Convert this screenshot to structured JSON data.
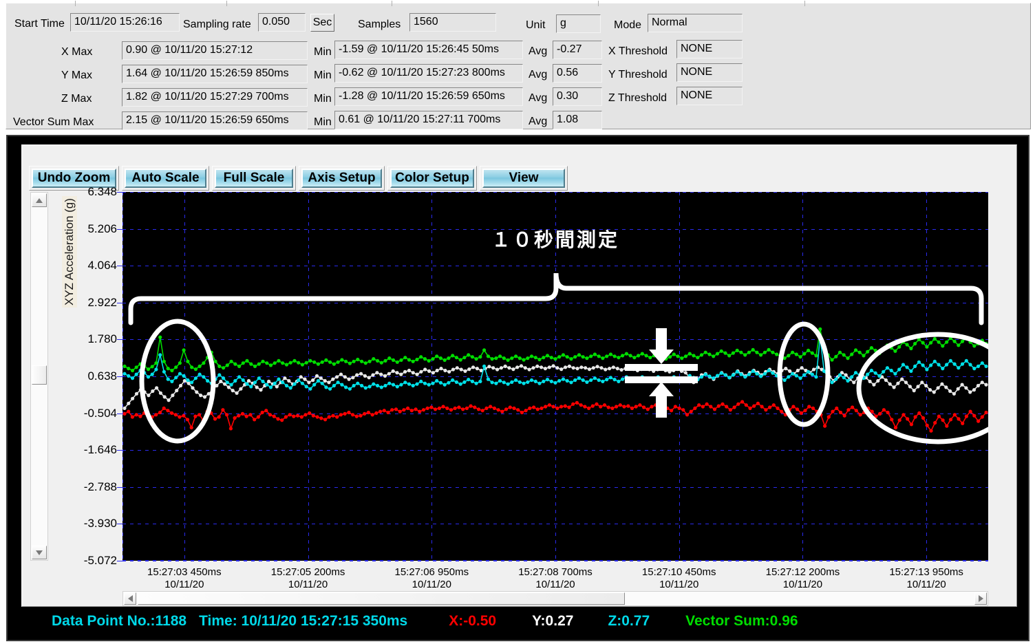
{
  "header": {
    "start_time_label": "Start Time",
    "start_time_value": "10/11/20 15:26:16",
    "sampling_rate_label": "Sampling rate",
    "sampling_rate_value": "0.050",
    "sec_button": "Sec",
    "samples_label": "Samples",
    "samples_value": "1560",
    "unit_label": "Unit",
    "unit_value": "g",
    "mode_label": "Mode",
    "mode_value": "Normal",
    "rows": [
      {
        "axis": "X  Max",
        "max_value": "0.90 @ 10/11/20 15:27:12",
        "min_label": "Min",
        "min_value": "-1.59 @ 10/11/20 15:26:45 50ms",
        "avg_label": "Avg",
        "avg_value": "-0.27",
        "threshold_label": "X Threshold",
        "threshold_value": "NONE"
      },
      {
        "axis": "Y Max",
        "max_value": "1.64 @ 10/11/20 15:26:59 850ms",
        "min_label": "Min",
        "min_value": "-0.62 @ 10/11/20 15:27:23 800ms",
        "avg_label": "Avg",
        "avg_value": "0.56",
        "threshold_label": "Y Threshold",
        "threshold_value": "NONE"
      },
      {
        "axis": "Z  Max",
        "max_value": "1.82 @ 10/11/20 15:27:29 700ms",
        "min_label": "Min",
        "min_value": "-1.28 @ 10/11/20 15:26:59 650ms",
        "avg_label": "Avg",
        "avg_value": "0.30",
        "threshold_label": "Z Threshold",
        "threshold_value": "NONE"
      },
      {
        "axis": "Vector Sum Max",
        "max_value": "2.15 @ 10/11/20 15:26:59 650ms",
        "min_label": "Min",
        "min_value": "0.61 @ 10/11/20 15:27:11 700ms",
        "avg_label": "Avg",
        "avg_value": "1.08",
        "threshold_label": "",
        "threshold_value": ""
      }
    ]
  },
  "toolbar": {
    "buttons": [
      {
        "label": "Undo Zoom",
        "name": "undo-zoom-button"
      },
      {
        "label": "Auto Scale",
        "name": "auto-scale-button"
      },
      {
        "label": "Full Scale",
        "name": "full-scale-button"
      },
      {
        "label": "Axis Setup",
        "name": "axis-setup-button"
      },
      {
        "label": "Color Setup",
        "name": "color-setup-button"
      },
      {
        "label": "View",
        "name": "view-button"
      }
    ]
  },
  "statusbar": {
    "data_point": "Data Point No.:1188",
    "time": "Time: 10/11/20 15:27:15 350ms",
    "x": "X:-0.50",
    "y": "Y:0.27",
    "z": "Z:0.77",
    "vector_sum": "Vector Sum:0.96",
    "colors": {
      "data_point": "#00d8e8",
      "time": "#00d8e8",
      "x": "#ff0000",
      "y": "#ffffff",
      "z": "#00d8e8",
      "vector_sum": "#00dd00"
    }
  },
  "annotations": {
    "bracket_text": "１０秒間測定",
    "ellipse_count": 3,
    "arrow_pair": "double-arrow-gap-marker"
  },
  "chart_data": {
    "type": "line",
    "title": "",
    "xlabel": "",
    "ylabel": "XYZ Acceleration (g)",
    "ylim": [
      -5.072,
      6.348
    ],
    "grid": true,
    "background": "#000000",
    "legend_position": "none",
    "yticks": [
      "6.348",
      "5.206",
      "4.064",
      "2.922",
      "1.780",
      "0.638",
      "-0.504",
      "-1.646",
      "-2.788",
      "-3.930",
      "-5.072"
    ],
    "ytick_values": [
      6.348,
      5.206,
      4.064,
      2.922,
      1.78,
      0.638,
      -0.504,
      -1.646,
      -2.788,
      -3.93,
      -5.072
    ],
    "xticks": [
      {
        "time": "15:27:03 450ms",
        "date": "10/11/20"
      },
      {
        "time": "15:27:05 200ms",
        "date": "10/11/20"
      },
      {
        "time": "15:27:06 950ms",
        "date": "10/11/20"
      },
      {
        "time": "15:27:08 700ms",
        "date": "10/11/20"
      },
      {
        "time": "15:27:10 450ms",
        "date": "10/11/20"
      },
      {
        "time": "15:27:12 200ms",
        "date": "10/11/20"
      },
      {
        "time": "15:27:13 950ms",
        "date": "10/11/20"
      }
    ],
    "series": [
      {
        "name": "X",
        "color": "#ff0000",
        "values": [
          -0.52,
          -0.45,
          -0.62,
          -0.55,
          -0.6,
          -0.5,
          -0.58,
          -0.62,
          -0.55,
          -0.48,
          -0.35,
          -0.42,
          -0.5,
          -0.55,
          -0.62,
          -0.58,
          -0.7,
          -0.95,
          -0.6,
          -0.55,
          -0.72,
          -0.45,
          -0.5,
          -0.68,
          -0.62,
          -0.4,
          -0.55,
          -0.98,
          -0.65,
          -0.58,
          -0.52,
          -0.6,
          -0.55,
          -0.7,
          -0.62,
          -0.48,
          -0.42,
          -0.55,
          -0.6,
          -0.68,
          -0.72,
          -0.62,
          -0.55,
          -0.6,
          -0.58,
          -0.62,
          -0.55,
          -0.5,
          -0.58,
          -0.62,
          -0.66,
          -0.7,
          -0.62,
          -0.58,
          -0.62,
          -0.55,
          -0.52,
          -0.48,
          -0.55,
          -0.6,
          -0.58,
          -0.52,
          -0.48,
          -0.55,
          -0.5,
          -0.45,
          -0.42,
          -0.48,
          -0.4,
          -0.38,
          -0.45,
          -0.4,
          -0.35,
          -0.42,
          -0.38,
          -0.45,
          -0.4,
          -0.35,
          -0.32,
          -0.38,
          -0.35,
          -0.3,
          -0.35,
          -0.4,
          -0.35,
          -0.32,
          -0.38,
          -0.35,
          -0.28,
          -0.32,
          -0.38,
          -0.42,
          -0.35,
          -0.3,
          -0.35,
          -0.4,
          -0.45,
          -0.38,
          -0.32,
          -0.35,
          -0.4,
          -0.48,
          -0.42,
          -0.35,
          -0.32,
          -0.38,
          -0.35,
          -0.3,
          -0.25,
          -0.3,
          -0.35,
          -0.3,
          -0.28,
          -0.32,
          -0.22,
          -0.18,
          -0.25,
          -0.3,
          -0.35,
          -0.28,
          -0.22,
          -0.3,
          -0.25,
          -0.32,
          -0.35,
          -0.3,
          -0.25,
          -0.3,
          -0.28,
          -0.35,
          -0.3,
          -0.25,
          -0.32,
          -0.38,
          -0.3,
          -0.25,
          -0.2,
          -0.28,
          -0.35,
          -0.42,
          -0.3,
          -0.35,
          -0.4,
          -0.55,
          -0.45,
          -0.35,
          -0.25,
          -0.3,
          -0.22,
          -0.3,
          -0.38,
          -0.28,
          -0.22,
          -0.3,
          -0.4,
          -0.32,
          -0.22,
          -0.15,
          -0.25,
          -0.35,
          -0.28,
          -0.2,
          -0.3,
          -0.4,
          -0.32,
          -0.25,
          -0.35,
          -0.45,
          -0.55,
          -0.4,
          -0.3,
          -0.38,
          -0.5,
          -0.42,
          -0.3,
          -0.35,
          -0.45,
          -0.55,
          -0.9,
          -0.62,
          -0.45,
          -0.35,
          -0.48,
          -0.58,
          -0.4,
          -0.32,
          -0.42,
          -0.55,
          -0.48,
          -0.35,
          -0.45,
          -0.6,
          -0.52,
          -0.4,
          -0.48,
          -0.7,
          -0.95,
          -0.72,
          -0.55,
          -0.68,
          -0.85,
          -0.62,
          -0.5,
          -0.65,
          -0.88,
          -1.05,
          -0.8,
          -0.6,
          -0.72,
          -0.9,
          -0.7,
          -0.55,
          -0.68,
          -0.82,
          -0.6,
          -0.45,
          -0.58,
          -0.75,
          -0.62,
          -0.48
        ]
      },
      {
        "name": "Y",
        "color": "#e8e8e8",
        "values": [
          -0.35,
          -0.2,
          -0.05,
          0.1,
          0.22,
          0.15,
          0.05,
          0.18,
          0.28,
          0.12,
          0.0,
          -0.1,
          0.05,
          0.2,
          0.35,
          0.5,
          0.42,
          0.28,
          0.15,
          0.05,
          0.0,
          0.1,
          0.22,
          0.35,
          0.48,
          0.4,
          0.3,
          0.2,
          0.12,
          0.25,
          0.38,
          0.5,
          0.42,
          0.3,
          0.22,
          0.35,
          0.48,
          0.4,
          0.32,
          0.45,
          0.58,
          0.5,
          0.4,
          0.48,
          0.62,
          0.55,
          0.45,
          0.52,
          0.65,
          0.58,
          0.5,
          0.45,
          0.55,
          0.62,
          0.7,
          0.62,
          0.55,
          0.6,
          0.68,
          0.72,
          0.65,
          0.6,
          0.68,
          0.75,
          0.7,
          0.65,
          0.72,
          0.8,
          0.75,
          0.7,
          0.78,
          0.82,
          0.75,
          0.7,
          0.78,
          0.85,
          0.8,
          0.75,
          0.82,
          0.88,
          0.82,
          0.78,
          0.85,
          0.9,
          0.85,
          0.8,
          0.86,
          0.92,
          0.88,
          0.82,
          0.88,
          0.94,
          0.9,
          0.85,
          0.9,
          0.95,
          0.9,
          0.86,
          0.92,
          0.96,
          0.9,
          0.85,
          0.9,
          0.95,
          0.92,
          0.88,
          0.92,
          0.96,
          0.9,
          0.86,
          0.92,
          0.95,
          0.9,
          0.88,
          0.92,
          0.9,
          0.86,
          0.9,
          0.94,
          0.9,
          0.85,
          0.88,
          0.92,
          0.88,
          0.84,
          0.88,
          0.92,
          0.86,
          0.82,
          0.86,
          0.9,
          0.85,
          0.8,
          0.85,
          0.88,
          0.82,
          0.78,
          0.82,
          0.86,
          0.8,
          0.75,
          0.6,
          0.45,
          0.55,
          0.68,
          0.72,
          0.62,
          0.55,
          0.65,
          0.75,
          0.68,
          0.6,
          0.7,
          0.8,
          0.72,
          0.65,
          0.75,
          0.82,
          0.76,
          0.68,
          0.78,
          0.85,
          0.78,
          0.72,
          0.82,
          0.88,
          0.8,
          0.72,
          0.82,
          0.9,
          0.82,
          0.75,
          0.85,
          0.92,
          0.85,
          0.78,
          0.62,
          0.5,
          0.62,
          0.75,
          0.68,
          0.55,
          0.45,
          0.58,
          0.7,
          0.6,
          0.48,
          0.38,
          0.5,
          0.62,
          0.52,
          0.4,
          0.3,
          0.42,
          0.55,
          0.45,
          0.32,
          0.2,
          0.32,
          0.45,
          0.35,
          0.22,
          0.15,
          0.28,
          0.4,
          0.3,
          0.18,
          0.1,
          0.25,
          0.38,
          0.28,
          0.15,
          0.22,
          0.35,
          0.45,
          0.38
        ]
      },
      {
        "name": "Z",
        "color": "#00e0e8",
        "values": [
          0.72,
          0.65,
          0.58,
          0.7,
          0.82,
          0.75,
          0.62,
          0.7,
          0.85,
          1.3,
          0.78,
          0.55,
          0.48,
          0.6,
          0.72,
          0.65,
          0.52,
          0.45,
          0.58,
          0.7,
          0.62,
          0.5,
          0.42,
          0.55,
          0.68,
          0.58,
          0.45,
          0.38,
          0.5,
          0.62,
          0.52,
          0.4,
          0.32,
          0.45,
          0.58,
          0.48,
          0.38,
          0.3,
          0.42,
          0.55,
          0.45,
          0.35,
          0.28,
          0.4,
          0.52,
          0.42,
          0.32,
          0.25,
          0.38,
          0.5,
          0.42,
          0.3,
          0.25,
          0.35,
          0.45,
          0.38,
          0.3,
          0.25,
          0.35,
          0.42,
          0.35,
          0.28,
          0.32,
          0.4,
          0.35,
          0.3,
          0.35,
          0.42,
          0.38,
          0.32,
          0.38,
          0.45,
          0.4,
          0.35,
          0.4,
          0.48,
          0.42,
          0.38,
          0.42,
          0.5,
          0.44,
          0.38,
          0.44,
          0.52,
          0.46,
          0.4,
          0.46,
          0.54,
          0.48,
          0.42,
          0.48,
          0.95,
          0.55,
          0.45,
          0.42,
          0.5,
          0.45,
          0.4,
          0.46,
          0.52,
          0.46,
          0.42,
          0.46,
          0.52,
          0.48,
          0.42,
          0.48,
          0.54,
          0.48,
          0.44,
          0.5,
          0.55,
          0.5,
          0.45,
          0.52,
          0.58,
          0.52,
          0.46,
          0.52,
          0.58,
          0.52,
          0.48,
          0.54,
          0.6,
          0.54,
          0.48,
          0.55,
          0.62,
          0.56,
          0.5,
          0.56,
          0.62,
          0.56,
          0.5,
          0.56,
          0.62,
          0.55,
          0.48,
          0.54,
          0.62,
          0.56,
          0.5,
          0.58,
          0.66,
          0.6,
          0.54,
          0.62,
          0.7,
          0.64,
          0.58,
          0.66,
          0.74,
          0.68,
          0.6,
          0.68,
          0.78,
          0.7,
          0.62,
          0.7,
          0.8,
          0.72,
          0.64,
          0.72,
          0.82,
          0.74,
          0.66,
          0.6,
          0.52,
          0.62,
          0.72,
          0.66,
          0.58,
          0.68,
          0.78,
          0.7,
          0.62,
          1.85,
          0.8,
          0.62,
          0.45,
          0.55,
          0.68,
          0.6,
          0.5,
          0.62,
          0.75,
          0.68,
          0.58,
          0.7,
          0.82,
          0.74,
          0.65,
          0.78,
          0.9,
          0.82,
          0.72,
          0.85,
          1.0,
          0.92,
          0.8,
          0.95,
          1.08,
          0.98,
          0.85,
          0.98,
          1.1,
          1.0,
          0.88,
          1.0,
          1.12,
          1.02,
          0.9,
          1.02,
          1.12,
          1.0,
          0.88,
          0.95,
          1.05,
          0.95
        ]
      },
      {
        "name": "Vector Sum",
        "color": "#00dd00",
        "values": [
          0.95,
          0.88,
          0.82,
          0.92,
          1.02,
          0.96,
          0.86,
          0.94,
          1.05,
          1.85,
          1.1,
          0.88,
          0.82,
          0.92,
          1.05,
          1.45,
          1.1,
          0.92,
          0.86,
          0.95,
          1.05,
          1.22,
          1.38,
          1.1,
          0.95,
          0.9,
          0.98,
          1.1,
          1.02,
          0.95,
          1.05,
          1.12,
          1.02,
          0.95,
          1.02,
          1.1,
          1.05,
          0.98,
          1.05,
          1.12,
          1.05,
          1.0,
          1.06,
          1.12,
          1.06,
          1.0,
          1.06,
          1.12,
          1.08,
          1.02,
          1.08,
          1.14,
          1.08,
          1.02,
          1.08,
          1.15,
          1.1,
          1.04,
          1.1,
          1.16,
          1.1,
          1.05,
          1.1,
          1.18,
          1.12,
          1.06,
          1.12,
          1.2,
          1.14,
          1.08,
          1.14,
          1.22,
          1.15,
          1.1,
          1.16,
          1.24,
          1.18,
          1.12,
          1.18,
          1.26,
          1.2,
          1.14,
          1.2,
          1.28,
          1.22,
          1.15,
          1.22,
          1.3,
          1.24,
          1.18,
          1.24,
          1.45,
          1.26,
          1.18,
          1.2,
          1.26,
          1.2,
          1.14,
          1.2,
          1.26,
          1.2,
          1.15,
          1.2,
          1.26,
          1.22,
          1.16,
          1.22,
          1.28,
          1.22,
          1.18,
          1.24,
          1.3,
          1.24,
          1.18,
          1.24,
          1.3,
          1.24,
          1.2,
          1.26,
          1.32,
          1.26,
          1.2,
          1.26,
          1.32,
          1.26,
          1.22,
          1.28,
          1.34,
          1.28,
          1.22,
          1.28,
          1.34,
          1.28,
          1.22,
          1.28,
          1.34,
          1.26,
          1.18,
          1.24,
          1.32,
          1.26,
          1.2,
          1.26,
          1.34,
          1.28,
          1.22,
          1.3,
          1.38,
          1.32,
          1.26,
          1.34,
          1.42,
          1.36,
          1.28,
          1.36,
          1.44,
          1.38,
          1.3,
          1.38,
          1.46,
          1.38,
          1.3,
          1.38,
          1.46,
          1.38,
          1.32,
          1.26,
          1.2,
          1.28,
          1.38,
          1.32,
          1.24,
          1.34,
          1.44,
          1.36,
          1.28,
          2.1,
          1.5,
          1.3,
          1.15,
          1.25,
          1.38,
          1.3,
          1.2,
          1.32,
          1.45,
          1.38,
          1.28,
          1.4,
          1.52,
          1.44,
          1.35,
          1.48,
          1.6,
          1.52,
          1.42,
          1.55,
          1.7,
          1.62,
          1.5,
          1.65,
          1.78,
          1.68,
          1.55,
          1.68,
          1.8,
          1.7,
          1.58,
          1.7,
          1.82,
          1.72,
          1.6,
          1.72,
          1.82,
          1.7,
          1.58,
          1.65,
          1.75,
          1.65
        ]
      }
    ]
  }
}
